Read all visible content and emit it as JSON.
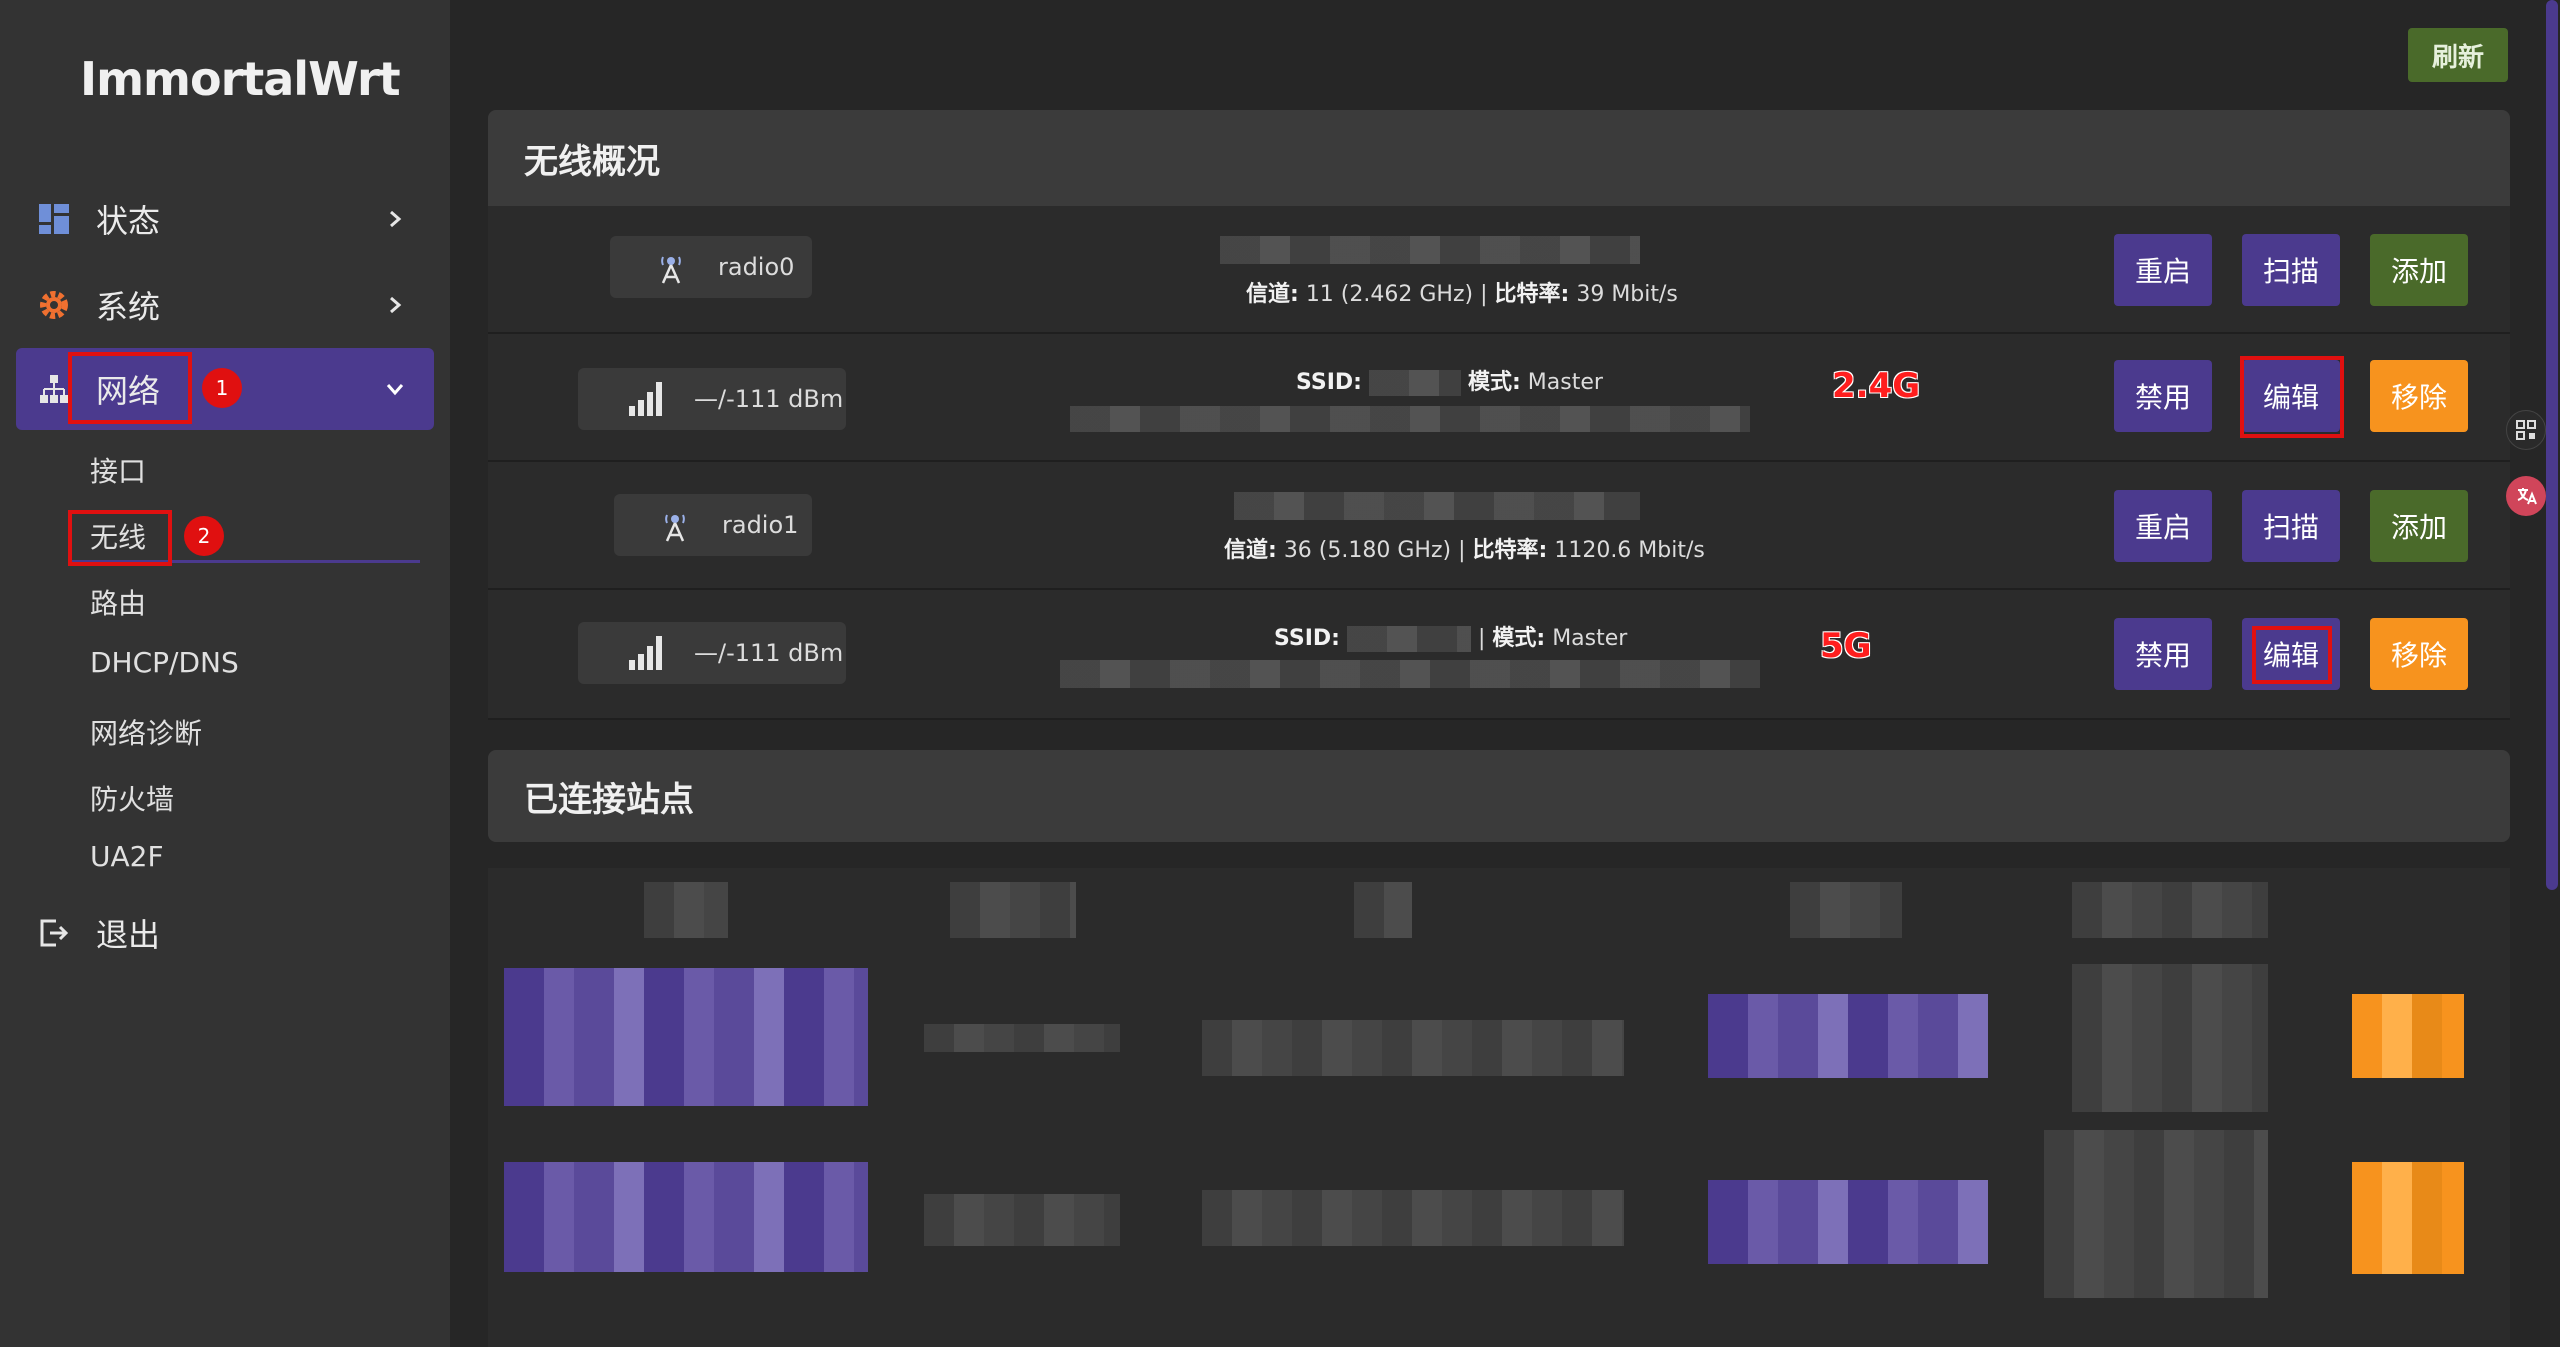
{
  "brand": "ImmortalWrt",
  "sidebar": {
    "items": [
      {
        "label": "状态",
        "icon": "dashboard-icon"
      },
      {
        "label": "系统",
        "icon": "gear-icon"
      },
      {
        "label": "网络",
        "icon": "network-icon"
      },
      {
        "label": "退出",
        "icon": "logout-icon"
      }
    ],
    "network_sub": [
      "接口",
      "无线",
      "路由",
      "DHCP/DNS",
      "网络诊断",
      "防火墙",
      "UA2F"
    ],
    "badges": [
      "1",
      "2"
    ]
  },
  "toolbar": {
    "refresh_label": "刷新"
  },
  "wireless_overview": {
    "title": "无线概况",
    "radio0": {
      "name": "radio0",
      "channel_line_label1": "信道:",
      "channel_line_value1": "11 (2.462 GHz)",
      "channel_line_sep": "|",
      "channel_line_label2": "比特率:",
      "channel_line_value2": "39 Mbit/s",
      "buttons": [
        "重启",
        "扫描",
        "添加"
      ]
    },
    "radio0_iface": {
      "signal": "—/-111 dBm",
      "ssid_label": "SSID:",
      "mode_label": "模式:",
      "mode_value": "Master",
      "band_label": "2.4G",
      "buttons": [
        "禁用",
        "编辑",
        "移除"
      ]
    },
    "radio1": {
      "name": "radio1",
      "channel_line_label1": "信道:",
      "channel_line_value1": "36 (5.180 GHz)",
      "channel_line_sep": "|",
      "channel_line_label2": "比特率:",
      "channel_line_value2": "1120.6 Mbit/s",
      "buttons": [
        "重启",
        "扫描",
        "添加"
      ]
    },
    "radio1_iface": {
      "signal": "—/-111 dBm",
      "ssid_label": "SSID:",
      "mode_sep": "|",
      "mode_label": "模式:",
      "mode_value": "Master",
      "band_label": "5G",
      "buttons": [
        "禁用",
        "编辑",
        "移除"
      ]
    }
  },
  "connected_stations": {
    "title": "已连接站点"
  },
  "colors": {
    "accent": "#4b3a8e",
    "success": "#4a6a2a",
    "warning": "#f7931e",
    "annotation": "#e01010"
  }
}
